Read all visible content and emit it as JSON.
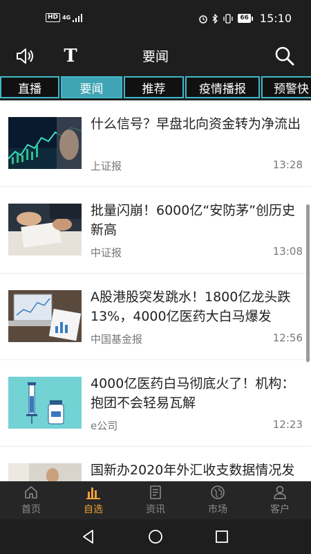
{
  "status_bar": {
    "hd": "HD",
    "network": "4G",
    "battery": "66",
    "time": "15:10"
  },
  "header": {
    "title": "要闻",
    "font_icon_label": "T"
  },
  "tabs": [
    {
      "label": "直播",
      "active": false
    },
    {
      "label": "要闻",
      "active": true
    },
    {
      "label": "推荐",
      "active": false
    },
    {
      "label": "疫情播报",
      "active": false
    },
    {
      "label": "预警快",
      "active": false
    }
  ],
  "news": [
    {
      "title": "什么信号？早盘北向资金转为净流出",
      "source": "上证报",
      "time": "13:28",
      "thumb": "chart-screen"
    },
    {
      "title": "批量闪崩！6000亿“安防茅”创历史新高",
      "source": "中证报",
      "time": "13:08",
      "thumb": "business-hands"
    },
    {
      "title": "A股港股突发跳水！1800亿龙头跌13%，4000亿医药大白马爆发",
      "source": "中国基金报",
      "time": "12:56",
      "thumb": "laptop-report"
    },
    {
      "title": "4000亿医药白马彻底火了！机构：抱团不会轻易瓦解",
      "source": "e公司",
      "time": "12:23",
      "thumb": "syringe-vial"
    },
    {
      "title": "国新办2020年外汇收支数据情况发",
      "source": "",
      "time": "",
      "thumb": "press-person"
    }
  ],
  "bottom_nav": [
    {
      "label": "首页",
      "icon": "home-icon",
      "active": false
    },
    {
      "label": "自选",
      "icon": "bar-chart-icon",
      "active": true
    },
    {
      "label": "资讯",
      "icon": "news-icon",
      "active": false
    },
    {
      "label": "市场",
      "icon": "globe-icon",
      "active": false
    },
    {
      "label": "客户",
      "icon": "user-icon",
      "active": false
    }
  ],
  "colors": {
    "accent": "#3fa4b4",
    "nav_active": "#f0a03a",
    "background": "#1e1e1e"
  }
}
